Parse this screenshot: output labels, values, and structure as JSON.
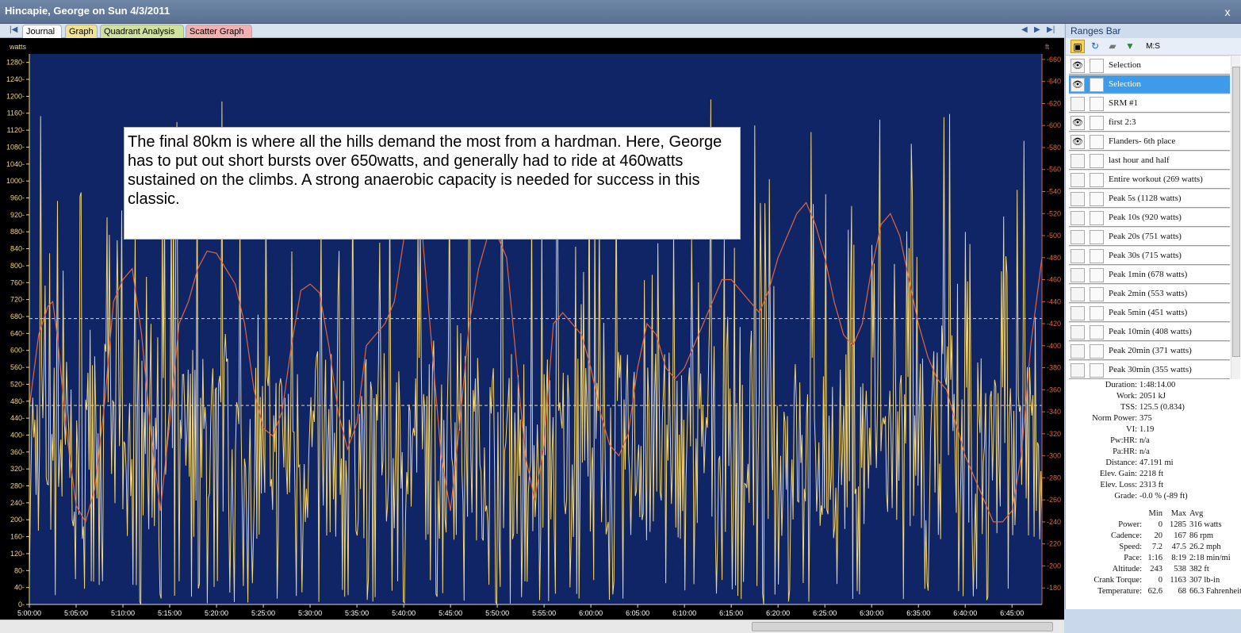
{
  "window": {
    "title": "Hincapie, George on Sun 4/3/2011",
    "close": "x"
  },
  "tabs": {
    "journal": "Journal",
    "graph": "Graph",
    "quadrant": "Quadrant Analysis",
    "scatter": "Scatter Graph",
    "nav_first": "|◀",
    "nav_prev": "◀",
    "nav_next": "▶",
    "nav_last": "▶|"
  },
  "annotation": {
    "text": "The final 80km is where all the hills demand the most from a hardman. Here, George has to put out short bursts over 650watts, and generally had to ride at 460watts sustained on the climbs. A strong anaerobic capacity is needed for success in this classic."
  },
  "ranges_bar": {
    "title": "Ranges Bar",
    "ms_label": "M:S",
    "items": [
      {
        "label": "Selection",
        "visible": true,
        "selected": false
      },
      {
        "label": "Selection",
        "visible": true,
        "selected": true
      },
      {
        "label": "SRM #1",
        "visible": false,
        "selected": false
      },
      {
        "label": "first 2:3",
        "visible": true,
        "selected": false
      },
      {
        "label": "Flanders- 6th place",
        "visible": true,
        "selected": false
      },
      {
        "label": "last hour and half",
        "visible": false,
        "selected": false
      },
      {
        "label": "Entire workout (269 watts)",
        "visible": false,
        "selected": false
      },
      {
        "label": "Peak 5s (1128 watts)",
        "visible": false,
        "selected": false
      },
      {
        "label": "Peak 10s (920 watts)",
        "visible": false,
        "selected": false
      },
      {
        "label": "Peak 20s (751 watts)",
        "visible": false,
        "selected": false
      },
      {
        "label": "Peak 30s (715 watts)",
        "visible": false,
        "selected": false
      },
      {
        "label": "Peak 1min (678 watts)",
        "visible": false,
        "selected": false
      },
      {
        "label": "Peak 2min (553 watts)",
        "visible": false,
        "selected": false
      },
      {
        "label": "Peak 5min (451 watts)",
        "visible": false,
        "selected": false
      },
      {
        "label": "Peak 10min (408 watts)",
        "visible": false,
        "selected": false
      },
      {
        "label": "Peak 20min (371 watts)",
        "visible": false,
        "selected": false
      },
      {
        "label": "Peak 30min (355 watts)",
        "visible": false,
        "selected": false
      }
    ]
  },
  "summary": [
    {
      "label": "Duration:",
      "value": "1:48:14.00"
    },
    {
      "label": "Work:",
      "value": "2051 kJ"
    },
    {
      "label": "TSS:",
      "value": "125.5 (0.834)"
    },
    {
      "label": "Norm Power:",
      "value": "375"
    },
    {
      "label": "VI:",
      "value": "1.19"
    },
    {
      "label": "Pw:HR:",
      "value": "n/a"
    },
    {
      "label": "Pa:HR:",
      "value": "n/a"
    },
    {
      "label": "Distance:",
      "value": "47.191 mi"
    },
    {
      "label": "Elev. Gain:",
      "value": "2218 ft"
    },
    {
      "label": "Elev. Loss:",
      "value": "2313 ft"
    },
    {
      "label": "Grade:",
      "value": "-0.0 % (-89 ft)"
    }
  ],
  "stats": {
    "header": {
      "label": "",
      "min": "Min",
      "max": "Max",
      "avg": "Avg"
    },
    "rows": [
      {
        "label": "Power:",
        "min": "0",
        "max": "1285",
        "avg": "316 watts"
      },
      {
        "label": "Cadence:",
        "min": "20",
        "max": "167",
        "avg": "86 rpm"
      },
      {
        "label": "Speed:",
        "min": "7.2",
        "max": "47.5",
        "avg": "26.2 mph"
      },
      {
        "label": "Pace:",
        "min": "1:16",
        "max": "8:19",
        "avg": "2:18 min/mi"
      },
      {
        "label": "Altitude:",
        "min": "243",
        "max": "538",
        "avg": "382 ft"
      },
      {
        "label": "Crank Torque:",
        "min": "0",
        "max": "1163",
        "avg": "307 lb-in"
      },
      {
        "label": "Temperature:",
        "min": "62.6",
        "max": "68",
        "avg": "66.3 Fahrenheit"
      }
    ]
  },
  "colors": {
    "plot_bg": "#0f2566",
    "power": "#f5d774",
    "altitude": "#e0663e",
    "axis_left": "#f5d774",
    "axis_right": "#e0663e",
    "refline": "#f5d774"
  },
  "chart_data": {
    "type": "line",
    "left_axis": {
      "label": "watts",
      "ticks": [
        0,
        40,
        80,
        120,
        160,
        200,
        240,
        280,
        320,
        360,
        400,
        440,
        480,
        520,
        560,
        600,
        640,
        680,
        720,
        760,
        800,
        840,
        880,
        920,
        960,
        1000,
        1040,
        1080,
        1120,
        1160,
        1200,
        1240,
        1280
      ],
      "ylim": [
        0,
        1300
      ]
    },
    "right_axis": {
      "label": "ft",
      "ticks": [
        180,
        200,
        220,
        240,
        260,
        280,
        300,
        320,
        340,
        360,
        380,
        400,
        420,
        440,
        460,
        480,
        500,
        520,
        540,
        560,
        580,
        600,
        620,
        640,
        660
      ],
      "ylim": [
        165,
        665
      ]
    },
    "x_ticks": [
      "5:00:00",
      "5:05:00",
      "5:10:00",
      "5:15:00",
      "5:20:00",
      "5:25:00",
      "5:30:00",
      "5:35:00",
      "5:40:00",
      "5:45:00",
      "5:50:00",
      "5:55:00",
      "6:00:00",
      "6:05:00",
      "6:10:00",
      "6:15:00",
      "6:20:00",
      "6:25:00",
      "6:30:00",
      "6:35:00",
      "6:40:00",
      "6:45:00"
    ],
    "xlim_min": [
      0,
      108.2
    ],
    "reference_lines": [
      {
        "axis": "left",
        "value": 675
      },
      {
        "axis": "left",
        "value": 470
      }
    ],
    "series": [
      {
        "name": "Altitude",
        "axis": "right",
        "x": [
          0,
          1,
          2,
          2.5,
          3,
          4,
          5,
          6,
          7,
          8,
          9,
          10,
          11,
          12,
          13,
          14,
          15,
          16,
          17,
          18,
          19,
          20,
          21,
          22,
          23,
          24,
          25,
          26,
          27,
          28,
          29,
          30,
          31,
          32,
          33,
          34,
          35,
          36,
          37,
          38,
          39,
          40,
          41,
          42,
          43,
          44,
          45,
          46,
          47,
          48,
          49,
          50,
          51,
          52,
          53,
          54,
          55,
          56,
          57,
          58,
          59,
          60,
          61,
          62,
          63,
          64,
          65,
          66,
          67,
          68,
          69,
          70,
          71,
          72,
          73,
          74,
          75,
          76,
          77,
          78,
          79,
          80,
          81,
          82,
          83,
          84,
          85,
          86,
          87,
          88,
          89,
          90,
          91,
          92,
          93,
          94,
          95,
          96,
          97,
          98,
          99,
          100,
          101,
          102,
          103,
          104,
          105,
          106,
          107,
          108.2
        ],
        "values": [
          344,
          410,
          436,
          440,
          408,
          320,
          255,
          240,
          270,
          344,
          440,
          460,
          470,
          410,
          320,
          250,
          330,
          420,
          440,
          470,
          486,
          484,
          470,
          456,
          420,
          360,
          325,
          318,
          340,
          400,
          450,
          456,
          448,
          400,
          340,
          306,
          330,
          400,
          410,
          420,
          440,
          496,
          524,
          500,
          400,
          300,
          250,
          330,
          420,
          470,
          500,
          500,
          480,
          390,
          300,
          260,
          310,
          420,
          430,
          420,
          410,
          380,
          340,
          310,
          300,
          320,
          380,
          420,
          410,
          380,
          370,
          380,
          400,
          420,
          440,
          460,
          460,
          450,
          440,
          430,
          450,
          480,
          500,
          520,
          530,
          510,
          480,
          440,
          410,
          400,
          420,
          470,
          510,
          520,
          500,
          460,
          420,
          390,
          370,
          360,
          330,
          300,
          280,
          260,
          240,
          240,
          250,
          300,
          400,
          480
        ]
      },
      {
        "name": "Power",
        "axis": "left",
        "x_range": [
          0,
          108.2
        ],
        "points": 900,
        "mean": 316,
        "max": 1285
      }
    ]
  }
}
